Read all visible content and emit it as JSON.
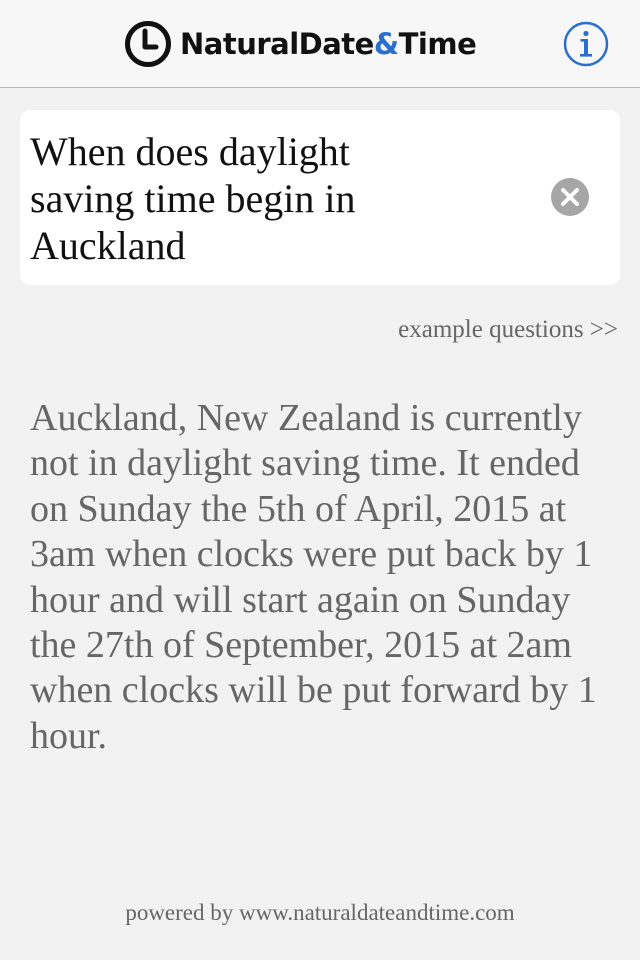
{
  "header": {
    "logo_icon": "clock-icon",
    "logo_text_part1": "NaturalDate",
    "logo_text_amp": "&",
    "logo_text_part2": "Time",
    "info_icon": "info-icon",
    "brand_color": "#2a6fcf"
  },
  "query": {
    "text": "When does daylight\nsaving time begin in\nAuckland",
    "clear_icon": "clear-icon"
  },
  "examples_link": "example questions >>",
  "answer": "Auckland, New Zealand is currently not in daylight saving time. It ended on Sunday the 5th of April, 2015 at 3am when clocks were put back by 1 hour and will start again on Sunday the 27th of September, 2015 at 2am when clocks will be put forward by 1 hour.",
  "footer": "powered by www.naturaldateandtime.com"
}
